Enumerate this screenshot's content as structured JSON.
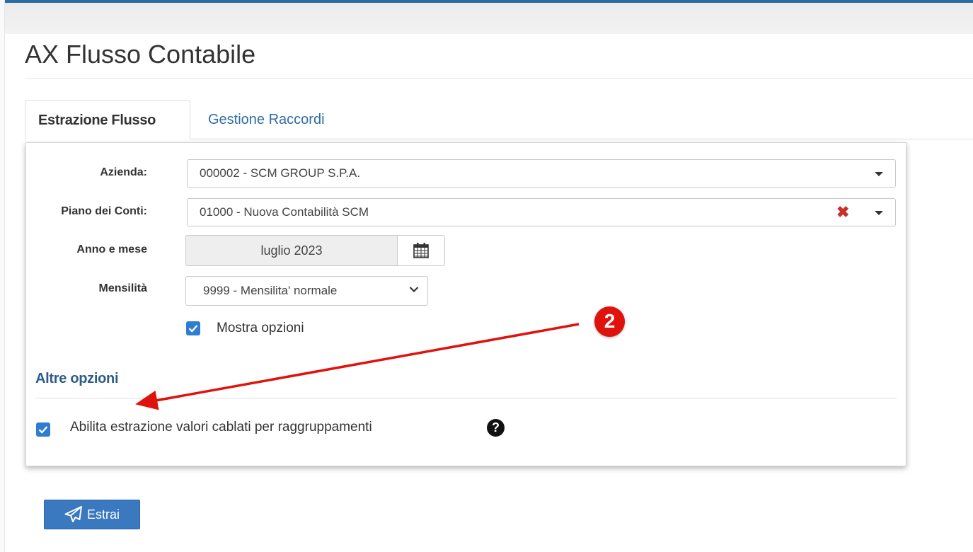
{
  "page": {
    "title": "AX Flusso Contabile"
  },
  "tabs": [
    {
      "label": "Estrazione Flusso",
      "active": true
    },
    {
      "label": "Gestione Raccordi",
      "active": false
    }
  ],
  "form": {
    "azienda": {
      "label": "Azienda:",
      "value": "000002 - SCM GROUP S.P.A."
    },
    "piano": {
      "label": "Piano dei Conti:",
      "value": "01000 - Nuova Contabilità SCM"
    },
    "anno": {
      "label": "Anno e mese",
      "value": "luglio 2023"
    },
    "mensilita": {
      "label": "Mensilità",
      "value": "9999 - Mensilita' normale"
    },
    "mostra_opzioni": {
      "label": "Mostra opzioni",
      "checked": true
    }
  },
  "altre_opzioni": {
    "title": "Altre opzioni",
    "abilita": {
      "label": "Abilita estrazione valori cablati per raggruppamenti",
      "checked": true
    },
    "help_icon": "question-circle-icon"
  },
  "annotation": {
    "badge": "2",
    "color": "#e0120c"
  },
  "actions": {
    "estrai_label": "Estrai",
    "estrai_icon": "paper-plane-icon"
  },
  "colors": {
    "accent": "#2e6da4",
    "button": "#3a78c0",
    "checkbox": "#2f7cd1",
    "clear": "#c9302c"
  }
}
